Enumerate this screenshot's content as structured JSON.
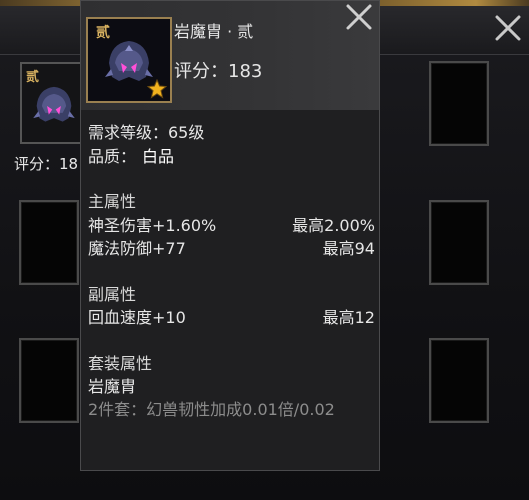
{
  "background_panel": {
    "item_grade": "贰",
    "score_label": "评分：18"
  },
  "tooltip": {
    "item_name": "岩魔胄 · 贰",
    "grade_badge": "贰",
    "score": "评分：183",
    "required_level": "需求等级：65级",
    "quality_label": "品质：",
    "quality_value": "白品",
    "main_attr": {
      "title": "主属性",
      "rows": [
        {
          "name": "神圣伤害+1.60%",
          "max": "最高2.00%"
        },
        {
          "name": "魔法防御+77",
          "max": "最高94"
        }
      ]
    },
    "sub_attr": {
      "title": "副属性",
      "rows": [
        {
          "name": "回血速度+10",
          "max": "最高12"
        }
      ]
    },
    "set_attr": {
      "title": "套装属性",
      "set_name": "岩魔胄",
      "bonus": "2件套：幻兽韧性加成0.01倍/0.02"
    }
  },
  "colors": {
    "frame_gold": "#9a8050",
    "grade_gold": "#d7b160",
    "inactive_text": "#8c8c8c"
  },
  "icons": [
    "close-icon",
    "helmet-icon",
    "star-icon"
  ]
}
